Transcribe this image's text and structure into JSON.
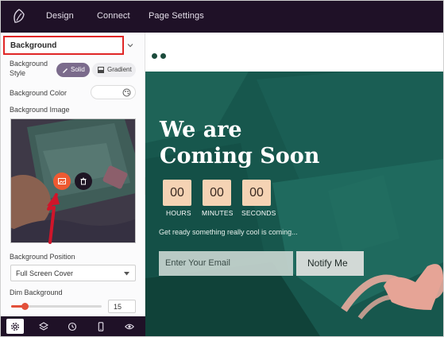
{
  "topbar": {
    "logo_icon": "leaf-logo-icon",
    "nav": [
      "Design",
      "Connect",
      "Page Settings"
    ]
  },
  "sidebar": {
    "section_title": "Background",
    "style_label": "Background Style",
    "style_options": {
      "solid": "Solid",
      "gradient": "Gradient",
      "selected": "Solid"
    },
    "color_label": "Background Color",
    "color_value": "#ffffff",
    "image_label": "Background Image",
    "position_label": "Background Position",
    "position_value": "Full Screen Cover",
    "dim_label": "Dim Background",
    "dim_value": "15",
    "dim_fraction": 0.15,
    "bottom_icons": [
      "settings-icon",
      "layers-icon",
      "history-icon",
      "mobile-icon",
      "eye-icon"
    ],
    "accent_color": "#e2503a"
  },
  "preview": {
    "headline_line1": "We are",
    "headline_line2": "Coming Soon",
    "countdown": {
      "hours": "00",
      "minutes": "00",
      "seconds": "00",
      "labels": [
        "HOURS",
        "MINUTES",
        "SECONDS"
      ]
    },
    "tagline": "Get ready something really cool is coming...",
    "email_placeholder": "Enter Your Email",
    "notify_label": "Notify Me",
    "bg_color": "#16564d"
  }
}
